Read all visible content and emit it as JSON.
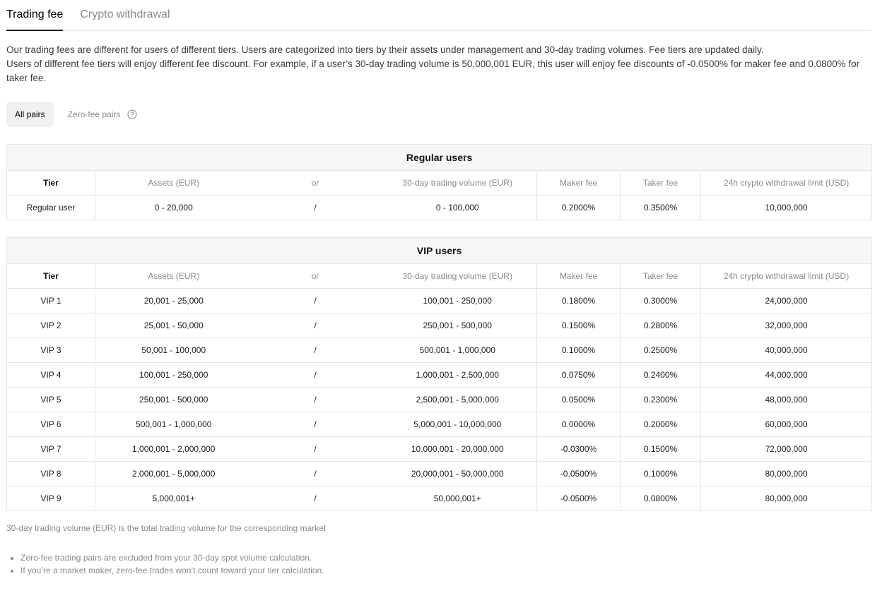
{
  "tabs": [
    {
      "label": "Trading fee",
      "active": true
    },
    {
      "label": "Crypto withdrawal",
      "active": false
    }
  ],
  "description": {
    "line1": "Our trading fees are different for users of different tiers. Users are categorized into tiers by their assets under management and 30-day trading volumes. Fee tiers are updated daily.",
    "line2": "Users of different fee tiers will enjoy different fee discount. For example, if a user’s 30-day trading volume is 50,000,001 EUR, this user will enjoy fee discounts of -0.0500% for maker fee and 0.0800% for taker fee."
  },
  "pair_filter": {
    "all_pairs": "All pairs",
    "zero_fee_pairs": "Zero-fee pairs",
    "help_icon": "question-circle-icon"
  },
  "headers": {
    "tier": "Tier",
    "assets": "Assets (EUR)",
    "or": "or",
    "volume": "30-day trading volume (EUR)",
    "maker": "Maker fee",
    "taker": "Taker fee",
    "limit": "24h crypto withdrawal limit (USD)"
  },
  "regular": {
    "title": "Regular users",
    "rows": [
      {
        "tier": "Regular user",
        "assets": "0 - 20,000",
        "sep": "/",
        "volume": "0 - 100,000",
        "maker": "0.2000%",
        "taker": "0.3500%",
        "limit": "10,000,000"
      }
    ]
  },
  "vip": {
    "title": "VIP users",
    "rows": [
      {
        "tier": "VIP 1",
        "assets": "20,001 - 25,000",
        "sep": "/",
        "volume": "100,001 - 250,000",
        "maker": "0.1800%",
        "taker": "0.3000%",
        "limit": "24,000,000"
      },
      {
        "tier": "VIP 2",
        "assets": "25,001 - 50,000",
        "sep": "/",
        "volume": "250,001 - 500,000",
        "maker": "0.1500%",
        "taker": "0.2800%",
        "limit": "32,000,000"
      },
      {
        "tier": "VIP 3",
        "assets": "50,001 - 100,000",
        "sep": "/",
        "volume": "500,001 - 1,000,000",
        "maker": "0.1000%",
        "taker": "0.2500%",
        "limit": "40,000,000"
      },
      {
        "tier": "VIP 4",
        "assets": "100,001 - 250,000",
        "sep": "/",
        "volume": "1,000,001 - 2,500,000",
        "maker": "0.0750%",
        "taker": "0.2400%",
        "limit": "44,000,000"
      },
      {
        "tier": "VIP 5",
        "assets": "250,001 - 500,000",
        "sep": "/",
        "volume": "2,500,001 - 5,000,000",
        "maker": "0.0500%",
        "taker": "0.2300%",
        "limit": "48,000,000"
      },
      {
        "tier": "VIP 6",
        "assets": "500,001 - 1,000,000",
        "sep": "/",
        "volume": "5,000,001 - 10,000,000",
        "maker": "0.0000%",
        "taker": "0.2000%",
        "limit": "60,000,000"
      },
      {
        "tier": "VIP 7",
        "assets": "1,000,001 - 2,000,000",
        "sep": "/",
        "volume": "10,000,001 - 20,000,000",
        "maker": "-0.0300%",
        "taker": "0.1500%",
        "limit": "72,000,000"
      },
      {
        "tier": "VIP 8",
        "assets": "2,000,001 - 5,000,000",
        "sep": "/",
        "volume": "20,000,001 - 50,000,000",
        "maker": "-0.0500%",
        "taker": "0.1000%",
        "limit": "80,000,000"
      },
      {
        "tier": "VIP 9",
        "assets": "5,000,001+",
        "sep": "/",
        "volume": "50,000,001+",
        "maker": "-0.0500%",
        "taker": "0.0800%",
        "limit": "80,000,000"
      }
    ]
  },
  "footnote": "30-day trading volume (EUR) is the total trading volume for the corresponding market",
  "notes": [
    "Zero-fee trading pairs are excluded from your 30-day spot volume calculation.",
    "If you’re a market maker, zero-fee trades won’t count toward your tier calculation."
  ]
}
